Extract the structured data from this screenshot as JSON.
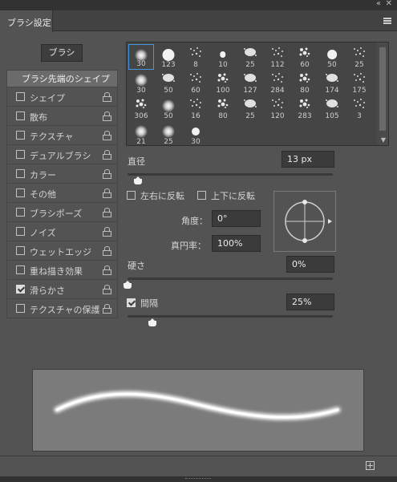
{
  "panel": {
    "tab_title": "ブラシ設定",
    "collapse_glyph": "‹‹",
    "close_glyph": "✕",
    "brush_button": "ブラシ"
  },
  "options": {
    "header": "ブラシ先端のシェイプ",
    "items": [
      {
        "label": "シェイプ",
        "checked": false
      },
      {
        "label": "散布",
        "checked": false
      },
      {
        "label": "テクスチャ",
        "checked": false
      },
      {
        "label": "デュアルブラシ",
        "checked": false
      },
      {
        "label": "カラー",
        "checked": false
      },
      {
        "label": "その他",
        "checked": false
      },
      {
        "label": "ブラシポーズ",
        "checked": false
      },
      {
        "label": "ノイズ",
        "checked": false
      },
      {
        "label": "ウェットエッジ",
        "checked": false
      },
      {
        "label": "重ね描き効果",
        "checked": false
      },
      {
        "label": "滑らかさ",
        "checked": true
      },
      {
        "label": "テクスチャの保護",
        "checked": false
      }
    ]
  },
  "brush_tips": {
    "selected_index": 0,
    "tips": [
      {
        "size": "30",
        "kind": "soft"
      },
      {
        "size": "123",
        "kind": "hard"
      },
      {
        "size": "8",
        "kind": "splat"
      },
      {
        "size": "10",
        "kind": "hard"
      },
      {
        "size": "25",
        "kind": "splat"
      },
      {
        "size": "112",
        "kind": "splat"
      },
      {
        "size": "60",
        "kind": "splat"
      },
      {
        "size": "50",
        "kind": "hard"
      },
      {
        "size": "25",
        "kind": "splat"
      },
      {
        "size": "30",
        "kind": "soft"
      },
      {
        "size": "50",
        "kind": "splat"
      },
      {
        "size": "60",
        "kind": "splat"
      },
      {
        "size": "100",
        "kind": "splat"
      },
      {
        "size": "127",
        "kind": "splat"
      },
      {
        "size": "284",
        "kind": "splat"
      },
      {
        "size": "80",
        "kind": "splat"
      },
      {
        "size": "174",
        "kind": "splat"
      },
      {
        "size": "175",
        "kind": "splat"
      },
      {
        "size": "306",
        "kind": "splat"
      },
      {
        "size": "50",
        "kind": "soft"
      },
      {
        "size": "16",
        "kind": "splat"
      },
      {
        "size": "80",
        "kind": "splat"
      },
      {
        "size": "25",
        "kind": "splat"
      },
      {
        "size": "120",
        "kind": "splat"
      },
      {
        "size": "283",
        "kind": "splat"
      },
      {
        "size": "105",
        "kind": "splat"
      },
      {
        "size": "3",
        "kind": "splat"
      },
      {
        "size": "21",
        "kind": "soft"
      },
      {
        "size": "25",
        "kind": "soft"
      },
      {
        "size": "30",
        "kind": "hard"
      }
    ]
  },
  "settings": {
    "diameter_label": "直径",
    "diameter_value": "13 px",
    "diameter_fraction": 0.05,
    "flip_x_label": "左右に反転",
    "flip_y_label": "上下に反転",
    "flip_x_checked": false,
    "flip_y_checked": false,
    "angle_label": "角度：",
    "angle_value": "0°",
    "roundness_label": "真円率：",
    "roundness_value": "100%",
    "hardness_label": "硬さ",
    "hardness_value": "0%",
    "hardness_fraction": 0.0,
    "spacing_label": "間隔",
    "spacing_value": "25%",
    "spacing_checked": true,
    "spacing_fraction": 0.12
  },
  "colors": {
    "panel_bg": "#535353",
    "selected_tip_border": "#4b94e0",
    "preview_bg": "#7b7b7b",
    "stroke": "#ffffff"
  },
  "icons": {
    "new_brush": "plus-square-icon",
    "menu": "hamburger-icon",
    "lock": "lock-icon"
  }
}
